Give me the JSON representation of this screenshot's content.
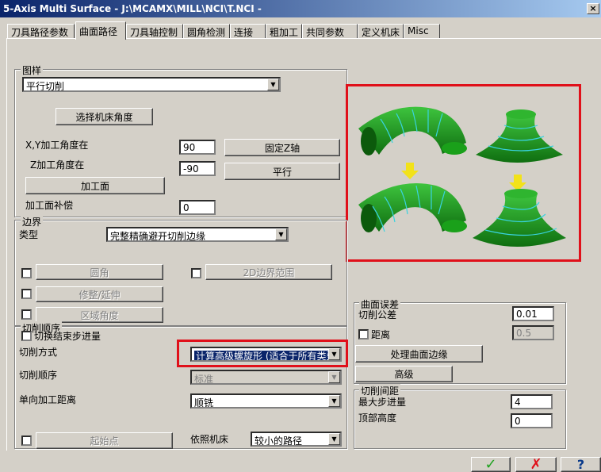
{
  "window": {
    "title": "5-Axis Multi Surface - J:\\MCAMX\\MILL\\NCI\\T.NCI -",
    "close_glyph": "×"
  },
  "tabs": [
    {
      "label": "刀具路径参数"
    },
    {
      "label": "曲面路径"
    },
    {
      "label": "刀具轴控制"
    },
    {
      "label": "圆角检测"
    },
    {
      "label": "连接"
    },
    {
      "label": "粗加工"
    },
    {
      "label": "共同参数"
    },
    {
      "label": "定义机床"
    },
    {
      "label": "Misc"
    }
  ],
  "pattern": {
    "group_label": "图样",
    "pattern_value": "平行切削",
    "select_machine_angle": "选择机床角度",
    "xy_angle_label": "X,Y加工角度在",
    "xy_angle_value": "90",
    "z_angle_label": "Z加工角度在",
    "z_angle_value": "-90",
    "fixed_z_button": "固定Z轴",
    "parallel_button": "平行",
    "surface_button": "加工面",
    "surface_comp_label": "加工面补偿",
    "surface_comp_value": "0"
  },
  "edge": {
    "group_label": "边界",
    "type_label": "类型",
    "type_value": "完整精确避开切削边缘",
    "fillet_button": "圆角",
    "boundary_2d_button": "2D边界范围",
    "trim_extend_button": "修整/延伸",
    "region_angle_button": "区域角度"
  },
  "order": {
    "group_label": "切削顺序",
    "toggle_stepover_label": "切换结束步进量",
    "cut_method_label": "切削方式",
    "cut_method_value": "计算高级螺旋形 (适合于所有类型)",
    "cut_order_label": "切削顺序",
    "cut_order_value": "标准",
    "one_way_label": "单向加工距离",
    "one_way_value": "顺铣",
    "start_point_button": "起始点",
    "by_machine_label": "依照机床",
    "by_machine_value": "较小的路径"
  },
  "tolerance": {
    "group_label": "曲面误差",
    "cut_tolerance_label": "切削公差",
    "cut_tolerance_value": "0.01",
    "distance_label": "距离",
    "distance_value": "0.5",
    "surface_edges_button": "处理曲面边缘",
    "advanced_button": "高级"
  },
  "stepover": {
    "group_label": "切削间距",
    "max_stepover_label": "最大步进量",
    "max_stepover_value": "4",
    "top_height_label": "顶部高度",
    "top_height_value": "0"
  },
  "footer": {
    "ok_glyph": "✓",
    "cancel_glyph": "✗",
    "help_glyph": "?"
  },
  "colors": {
    "accent_red": "#e0101a",
    "model_green": "#1f9e1f",
    "toolpath_cyan": "#39d3e0",
    "arrow_yellow": "#f2e21a"
  }
}
